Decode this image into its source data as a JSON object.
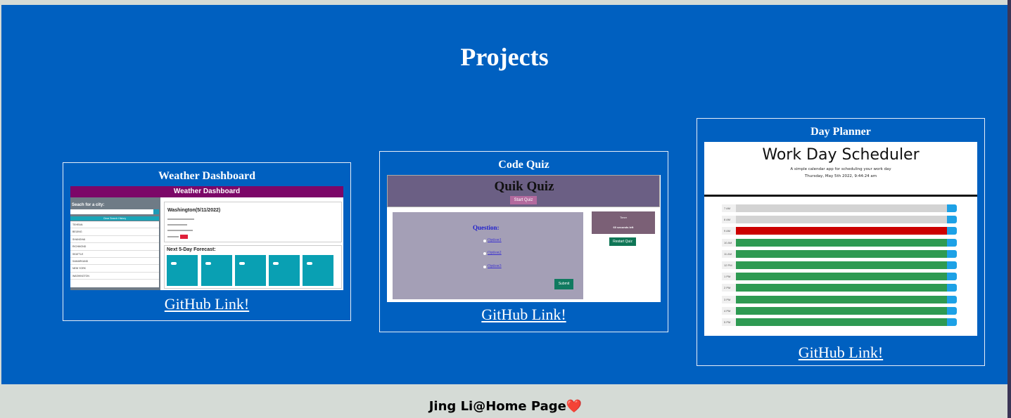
{
  "page": {
    "heading": "Projects",
    "footer_text": "Jing Li@Home Page",
    "footer_icon": "❤️"
  },
  "colors": {
    "main_background": "#0060c0",
    "page_background": "#d5dbd6",
    "text": "#ffffff"
  },
  "projects": [
    {
      "title": "Weather Dashboard",
      "link_label": "GitHub Link!",
      "preview": {
        "header": "Weather Dashboard",
        "search_label": "Seach for a city:",
        "clear_label": "Clear Search History",
        "cities": [
          "TEHRAN",
          "BEIJING",
          "SHANGHAI",
          "RICHMOND",
          "SEATTLE",
          "SAMARKAND",
          "NEW YORK",
          "WASHINGTON"
        ],
        "current_city": "Washington(5/11/2022)",
        "forecast_label": "Next 5-Day Forecast:"
      }
    },
    {
      "title": "Code Quiz",
      "link_label": "GitHub Link!",
      "preview": {
        "header": "Quik Quiz",
        "start_label": "Start Quiz",
        "question_label": "Question:",
        "options": [
          "Option1",
          "Option2",
          "Option3"
        ],
        "submit_label": "Submit",
        "timer_title": "Timer",
        "timer_text": "60 seconds left",
        "restart_label": "Restart Quiz"
      }
    },
    {
      "title": "Day Planner",
      "link_label": "GitHub Link!",
      "preview": {
        "header": "Work Day Scheduler",
        "subtitle": "A simple calendar app for scheduling your work day",
        "date_line": "Thursday, May 5th 2022, 9:44:24 am",
        "hours": [
          "7 AM",
          "8 AM",
          "9 AM",
          "10 AM",
          "11 AM",
          "12 PM",
          "1 PM",
          "2 PM",
          "3 PM",
          "4 PM",
          "5 PM"
        ],
        "hour_states": [
          "past",
          "past",
          "present",
          "future",
          "future",
          "future",
          "future",
          "future",
          "future",
          "future",
          "future"
        ]
      }
    }
  ]
}
